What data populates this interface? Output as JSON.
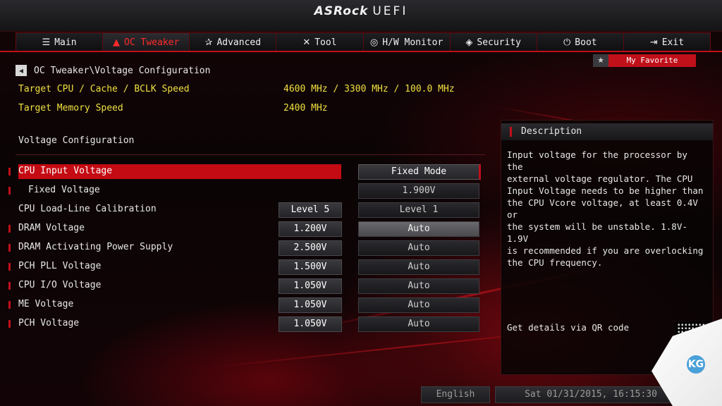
{
  "brand": {
    "logo": "ASRock",
    "title": "UEFI"
  },
  "tabs": [
    {
      "label": "Main",
      "icon": "list-icon"
    },
    {
      "label": "OC Tweaker",
      "icon": "rocket-icon"
    },
    {
      "label": "Advanced",
      "icon": "star-icon"
    },
    {
      "label": "Tool",
      "icon": "tools-icon"
    },
    {
      "label": "H/W Monitor",
      "icon": "monitor-icon"
    },
    {
      "label": "Security",
      "icon": "shield-icon"
    },
    {
      "label": "Boot",
      "icon": "power-icon"
    },
    {
      "label": "Exit",
      "icon": "exit-icon"
    }
  ],
  "active_tab": "OC Tweaker",
  "favorite": {
    "label": "My Favorite"
  },
  "breadcrumb": "OC Tweaker\\Voltage Configuration",
  "info": [
    {
      "label": "Target CPU / Cache / BCLK Speed",
      "value": "4600 MHz / 3300 MHz / 100.0 MHz"
    },
    {
      "label": "Target Memory Speed",
      "value": "2400 MHz"
    }
  ],
  "section_title": "Voltage Configuration",
  "rows": [
    {
      "label": "CPU Input Voltage",
      "current": "",
      "setting": "Fixed Mode"
    },
    {
      "label": "Fixed Voltage",
      "current": "",
      "setting": "1.900V"
    },
    {
      "label": "CPU Load-Line Calibration",
      "current": "Level 5",
      "setting": "Level 1"
    },
    {
      "label": "DRAM Voltage",
      "current": "1.200V",
      "setting": "Auto"
    },
    {
      "label": "DRAM Activating Power Supply",
      "current": "2.500V",
      "setting": "Auto"
    },
    {
      "label": "PCH PLL Voltage",
      "current": "1.500V",
      "setting": "Auto"
    },
    {
      "label": "CPU I/O Voltage",
      "current": "1.050V",
      "setting": "Auto"
    },
    {
      "label": "ME Voltage",
      "current": "1.050V",
      "setting": "Auto"
    },
    {
      "label": "PCH Voltage",
      "current": "1.050V",
      "setting": "Auto"
    }
  ],
  "description": {
    "title": "Description",
    "lines": [
      "Input voltage for the processor by the",
      "external voltage regulator. The CPU",
      "Input Voltage needs to be higher than",
      "the CPU Vcore voltage, at least 0.4V or",
      "the system will be unstable. 1.8V-1.9V",
      "is recommended if you are overlocking",
      "the CPU frequency."
    ],
    "qr_label": "Get details via QR code"
  },
  "footer": {
    "language": "English",
    "datetime": "Sat 01/31/2015, 16:15:30"
  },
  "watermark": "KG",
  "colors": {
    "accent": "#c0101a",
    "info_text": "#f0e040"
  }
}
